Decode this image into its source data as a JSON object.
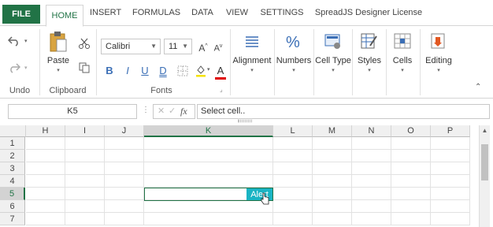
{
  "tabs": [
    {
      "label": "FILE"
    },
    {
      "label": "HOME"
    },
    {
      "label": "INSERT"
    },
    {
      "label": "FORMULAS"
    },
    {
      "label": "DATA"
    },
    {
      "label": "VIEW"
    },
    {
      "label": "SETTINGS"
    },
    {
      "label": "SpreadJS Designer License"
    }
  ],
  "ribbon": {
    "undo_group": "Undo",
    "clipboard_group": "Clipboard",
    "paste_label": "Paste",
    "fonts_group": "Fonts",
    "font_name": "Calibri",
    "font_size": "11",
    "bold": "B",
    "italic": "I",
    "underline": "U",
    "double_underline": "D",
    "alignment": "Alignment",
    "numbers": "Numbers",
    "cell_type": "Cell Type",
    "styles": "Styles",
    "cells": "Cells",
    "editing": "Editing"
  },
  "formula_bar": {
    "name_box": "K5",
    "fx": "fx",
    "value": "Select cell.."
  },
  "grid": {
    "columns": [
      "H",
      "I",
      "J",
      "K",
      "L",
      "M",
      "N",
      "O",
      "P"
    ],
    "rows": [
      "1",
      "2",
      "3",
      "4",
      "5",
      "6",
      "7"
    ],
    "selected_column": "K",
    "selected_row": "5",
    "cell_button_label": "Alert"
  },
  "colors": {
    "accent": "#217346",
    "button_fill": "#1ab4c4"
  }
}
